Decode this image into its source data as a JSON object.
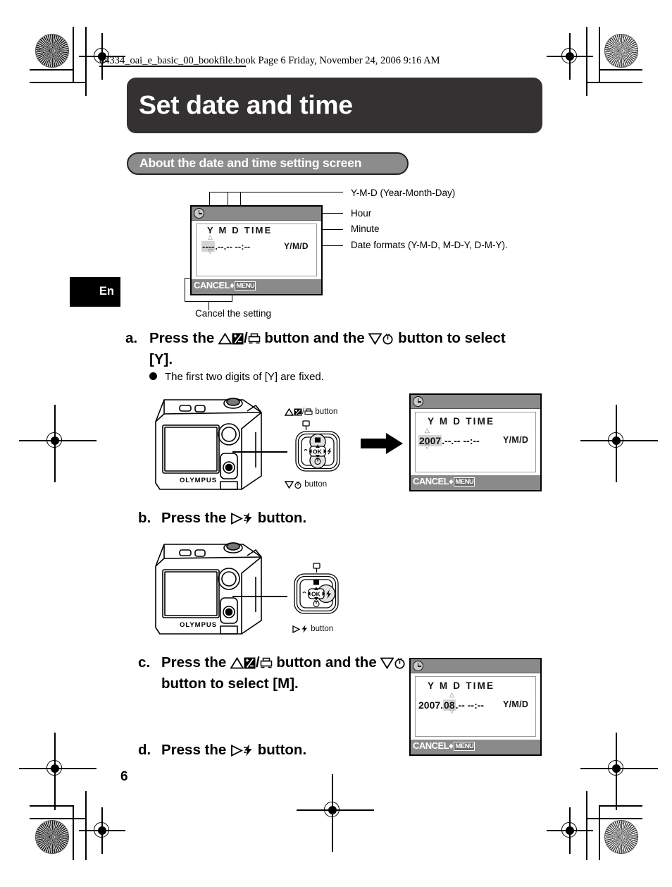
{
  "print": {
    "file_header": "d4334_oai_e_basic_00_bookfile.book  Page 6  Friday, November 24, 2006  9:16 AM"
  },
  "header": {
    "title": "Set date and time",
    "subsection": "About the date and time setting screen"
  },
  "language_tab": "En",
  "page_number": "6",
  "colors": {
    "title_bar": "#333132",
    "pill_fill": "#8c8c8c",
    "pill_border": "#231f20",
    "lcd_bar": "#8a8a8a",
    "highlight": "#d4d4d4"
  },
  "diagram": {
    "callouts": [
      {
        "label": "Y-M-D (Year-Month-Day)"
      },
      {
        "label": "Hour"
      },
      {
        "label": "Minute"
      },
      {
        "label": "Date formats (Y-M-D, M-D-Y, D-M-Y)."
      }
    ],
    "cancel_caption": "Cancel the setting",
    "screen": {
      "header_row": "Y  M  D TIME",
      "year": "----",
      "month": "--",
      "day": "--",
      "hour": "--",
      "minute": "--",
      "separator_date": ".",
      "separator_time": ":",
      "format": "Y/M/D",
      "cancel_label": "CANCEL",
      "cancel_diamond": "♦",
      "menu_tag": "MENU"
    }
  },
  "steps": [
    {
      "id": "a",
      "label": "a.",
      "text_part1": "Press the ",
      "text_part2": " button and the ",
      "text_part3": " button to select [Y].",
      "icons": [
        "triangle-up-icon",
        "exposure-comp-icon",
        "print-icon",
        "triangle-down-icon",
        "self-timer-icon"
      ],
      "bullet": "The first two digits of [Y] are fixed.",
      "pad_top_label": "button",
      "pad_bottom_label": "button",
      "lcd": {
        "header_row": "Y  M  D TIME",
        "year": "2007",
        "month": "--",
        "day": "--",
        "hour": "--",
        "minute": "--",
        "format": "Y/M/D",
        "cancel_label": "CANCEL",
        "menu_tag": "MENU"
      }
    },
    {
      "id": "b",
      "label": "b.",
      "text_part1": "Press the ",
      "text_part3": " button.",
      "icons": [
        "triangle-right-icon",
        "flash-icon"
      ],
      "pad_bottom_label": "button"
    },
    {
      "id": "c",
      "label": "c.",
      "text_part1": "Press the ",
      "text_part2": " button and the ",
      "text_part3": " button to select [M].",
      "icons": [
        "triangle-up-icon",
        "exposure-comp-icon",
        "print-icon",
        "triangle-down-icon",
        "self-timer-icon"
      ],
      "lcd": {
        "header_row": "Y  M  D TIME",
        "year": "2007",
        "month": "08",
        "day": "--",
        "hour": "--",
        "minute": "--",
        "format": "Y/M/D",
        "cancel_label": "CANCEL",
        "menu_tag": "MENU"
      }
    },
    {
      "id": "d",
      "label": "d.",
      "text_part1": "Press the ",
      "text_part3": " button.",
      "icons": [
        "triangle-right-icon",
        "flash-icon"
      ]
    }
  ],
  "camera": {
    "brand": "OLYMPUS"
  }
}
